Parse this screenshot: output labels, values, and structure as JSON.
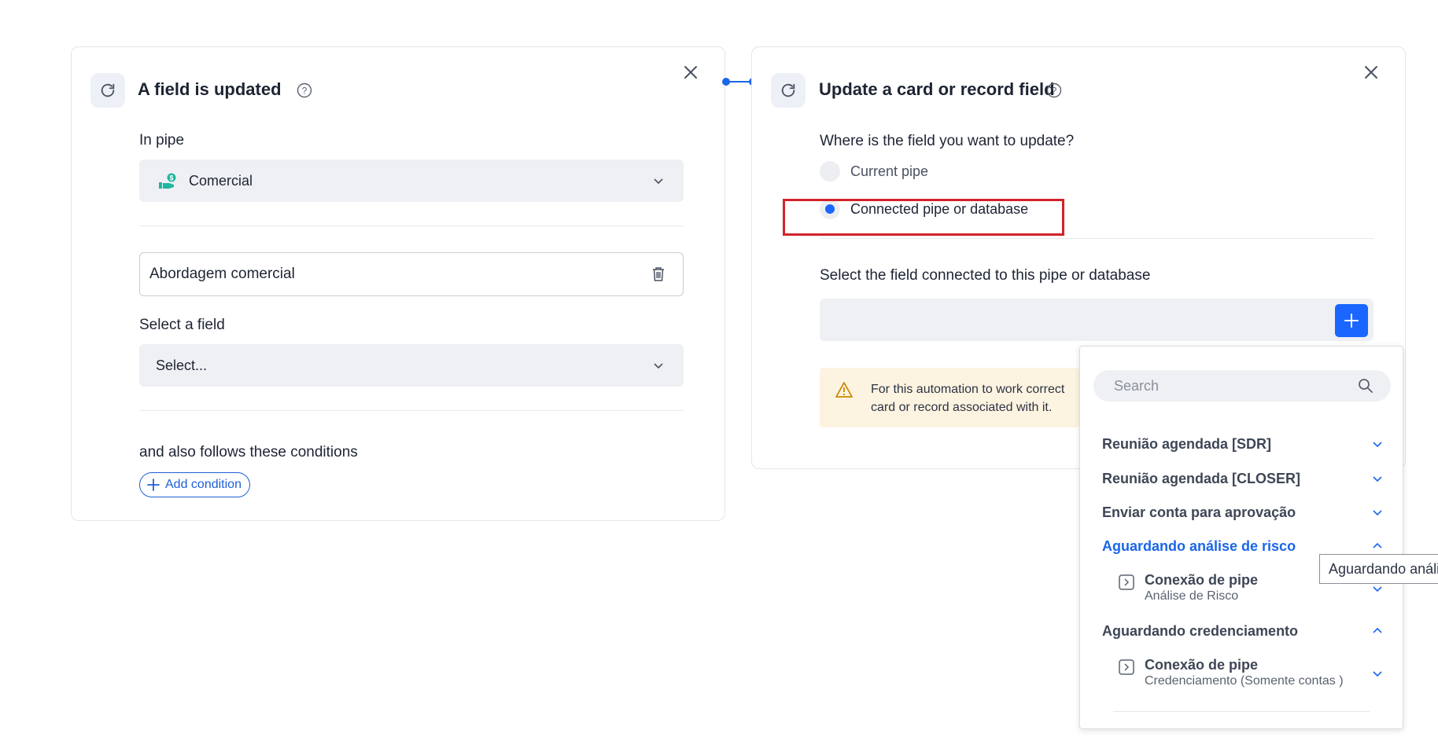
{
  "left_card": {
    "title": "A field is updated",
    "in_pipe_label": "In pipe",
    "pipe_value": "Comercial",
    "phase_value": "Abordagem comercial",
    "select_field_label": "Select a field",
    "select_field_placeholder": "Select...",
    "conditions_label": "and also follows these conditions",
    "add_condition_label": "Add condition"
  },
  "right_card": {
    "title": "Update a card or record field",
    "question": "Where is the field you want to update?",
    "options": [
      {
        "label": "Current pipe",
        "selected": false
      },
      {
        "label": "Connected pipe or database",
        "selected": true
      }
    ],
    "connected_field_label": "Select the field connected to this pipe or database",
    "warning_line1": "For this automation to work correct",
    "warning_line2": "card or record associated with it."
  },
  "dropdown": {
    "search_placeholder": "Search",
    "groups": [
      {
        "label": "Reunião agendada [SDR]",
        "expanded": false
      },
      {
        "label": "Reunião agendada [CLOSER]",
        "expanded": false
      },
      {
        "label": "Enviar conta para aprovação",
        "expanded": false
      },
      {
        "label": "Aguardando análise de risco",
        "expanded": true,
        "active": true,
        "items": [
          {
            "title": "Conexão de pipe",
            "subtitle": "Análise de Risco"
          }
        ]
      },
      {
        "label": "Aguardando credenciamento",
        "expanded": true,
        "items": [
          {
            "title": "Conexão de pipe",
            "subtitle": "Credenciamento (Somente contas )"
          }
        ]
      }
    ]
  },
  "tooltip": {
    "text": "Aguardando análi"
  },
  "colors": {
    "accent": "#1a66ff",
    "highlight": "#d3222a",
    "warning_bg": "#fdf3e1"
  }
}
